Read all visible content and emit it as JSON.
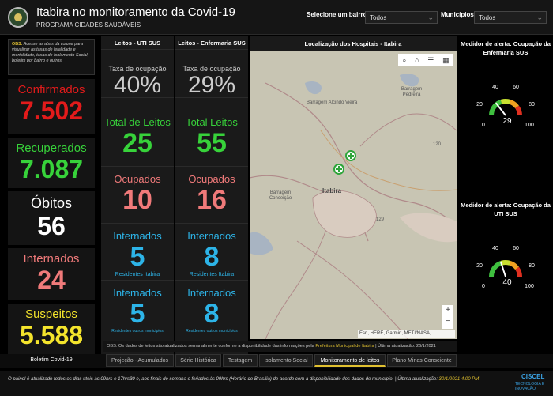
{
  "header": {
    "title": "Itabira no monitoramento da Covid-19",
    "subtitle": "PROGRAMA CIDADES SAUDÁVEIS",
    "bairro_label": "Selecione um bairro:",
    "bairro_value": "Todos",
    "municipio_label": "Municípios:",
    "municipio_value": "Todos"
  },
  "obs": {
    "prefix": "OBS:",
    "text": " Acesse as abas da coluna para visualizar as taxas de letalidade e mortalidade, taxas de Isolamento Social, boletim por bairro e outros"
  },
  "stats": [
    {
      "label": "Confirmados",
      "value": "7.502",
      "color": "#e21b1b"
    },
    {
      "label": "Recuperados",
      "value": "7.087",
      "color": "#37d23a"
    },
    {
      "label": "Óbitos",
      "value": "56",
      "color": "#ffffff"
    },
    {
      "label": "Internados",
      "value": "24",
      "color": "#f07a7a"
    },
    {
      "label": "Suspeitos",
      "value": "5.588",
      "color": "#f4e42c"
    }
  ],
  "uti": {
    "header": "Leitos - UTI SUS",
    "taxa_label": "Taxa de ocupação",
    "taxa_value": "40%",
    "total_label": "Total de Leitos",
    "total_value": "25",
    "ocup_label": "Ocupados",
    "ocup_value": "10",
    "int_label": "Internados",
    "int_value": "5",
    "res_label": "Residentes Itabira",
    "int2_label": "Internados",
    "int2_value": "5",
    "res2_label": "Residentes outros municípios"
  },
  "enf": {
    "header": "Leitos - Enfermaria SUS",
    "taxa_label": "Taxa de ocupação",
    "taxa_value": "29%",
    "total_label": "Total Leitos",
    "total_value": "55",
    "ocup_label": "Ocupados",
    "ocup_value": "16",
    "int_label": "Internados",
    "int_value": "8",
    "res_label": "Residentes Itabira",
    "int2_label": "Internados",
    "int2_value": "8",
    "res2_label": "Residentes outros municípios"
  },
  "map": {
    "title": "Localização dos Hospitais - Itabira",
    "labels": {
      "barragem_alcindo": "Barragem Alcindo Vieira",
      "barragem_pedreira": "Barragem Pedreira",
      "barragem_conceicao": "Barragem Conceição",
      "itabira": "Itabira",
      "road_120": "120",
      "road_129": "129"
    },
    "attribution": "Esri, HERE, Garmin, METI/NASA, ..."
  },
  "note": {
    "text": "OBS: Os dados de leitos são atualizados semanalmente conforme a disponibilidade das informações pela ",
    "link": "Prefeitura Municipal de Itabira",
    "update_label": " | Última atualização: ",
    "update_value": "26/1/2021"
  },
  "gauge_enf": {
    "title": "Medidor de alerta: Ocupação da Enfermaria SUS",
    "value": 29,
    "value_text": "29",
    "ticks": [
      "0",
      "20",
      "40",
      "60",
      "80",
      "100"
    ]
  },
  "gauge_uti": {
    "title": "Medidor de alerta: Ocupação da UTI SUS",
    "value": 40,
    "value_text": "40",
    "ticks": [
      "0",
      "20",
      "40",
      "60",
      "80",
      "100"
    ]
  },
  "tabs": {
    "boletim": "Boletim Covid-19",
    "t1": "Projeção - Acumulados",
    "t2": "Série Histórica",
    "t3": "Testagem",
    "t4": "Isolamento Social",
    "t5": "Monitoramento de leitos",
    "t6": "Plano Minas Consciente"
  },
  "footer": {
    "text": "O painel é atualizado todos os dias úteis às 09hrs e 17hrs30 e, aos finais de semana e feriados às 09hrs (Horário de Brasília) de acordo com a disponibilidade dos dados do município. | Última atualização: ",
    "date": "30/1/2021 4:00 PM",
    "brand": "CISCEL",
    "brand_sub": "TECNOLOGIA E INOVAÇÃO"
  }
}
